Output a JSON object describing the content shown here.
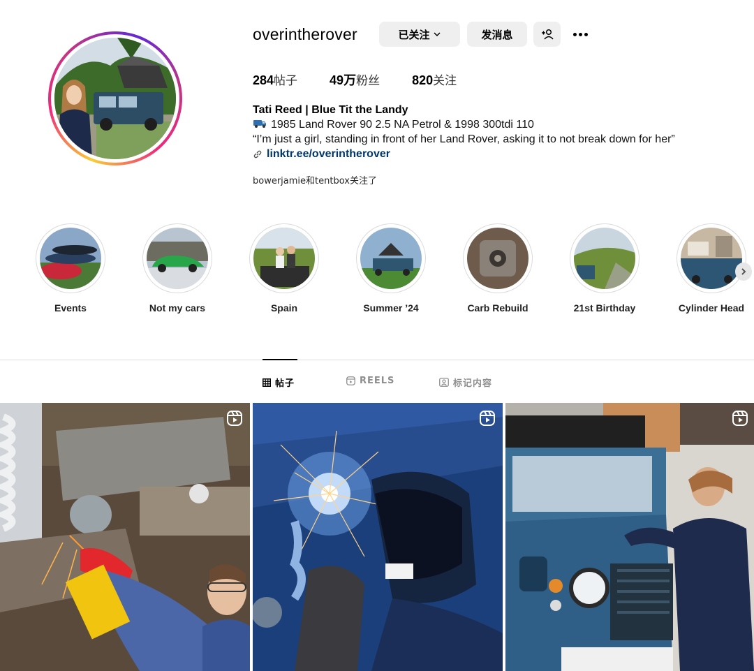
{
  "profile": {
    "username": "overintherover",
    "following_label": "已关注",
    "message_label": "发消息",
    "posts_count": "284",
    "posts_label": "帖子",
    "followers_count": "49万",
    "followers_label": "粉丝",
    "following_count": "820",
    "following_count_label": "关注",
    "full_name": "Tati Reed | Blue Tit the Landy",
    "bio_line1": "1985 Land Rover 90 2.5 NA Petrol & 1998 300tdi 110",
    "bio_line2": "“I’m just a girl, standing in front of her Land Rover, asking it to not break down for her”",
    "link": "linktr.ee/overintherover",
    "followed_by": "bowerjamie和tentbox关注了"
  },
  "highlights": [
    {
      "label": "Events"
    },
    {
      "label": "Not my cars"
    },
    {
      "label": "Spain"
    },
    {
      "label": "Summer ’24"
    },
    {
      "label": "Carb Rebuild"
    },
    {
      "label": "21st Birthday"
    },
    {
      "label": "Cylinder Head"
    }
  ],
  "tabs": {
    "posts": "帖子",
    "reels": "REELS",
    "tagged": "标记内容"
  },
  "colors": {
    "link": "#00376b",
    "button_bg": "#efefef",
    "divider": "#dbdbdb",
    "inactive_tab": "#8e8e8e"
  },
  "icons": {
    "truck": "truck-emoji-icon",
    "link": "link-icon",
    "add_user": "add-user-icon",
    "more": "more-icon",
    "reel": "reel-icon"
  }
}
